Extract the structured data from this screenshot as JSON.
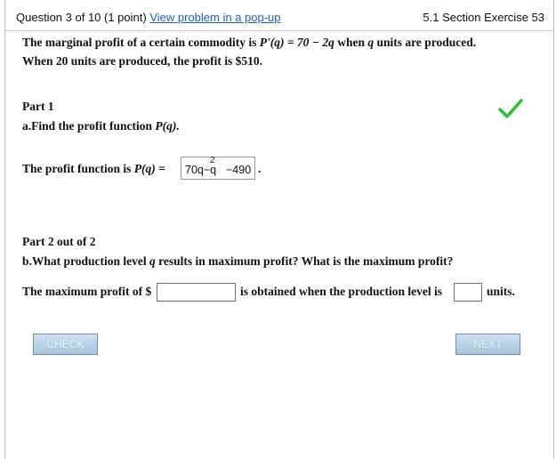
{
  "header": {
    "question_prefix": "Question 3 of 10 (1 point)",
    "popup_link": "View problem in a pop-up",
    "section": "5.1 Section Exercise 53"
  },
  "problem": {
    "line1_a": "The marginal profit of a certain commodity is ",
    "line1_expr": "P'(q) = 70 − 2q",
    "line1_b": " when ",
    "line1_q": "q",
    "line1_c": " units are produced.",
    "line2": "When 20 units are produced, the profit is $510."
  },
  "part1": {
    "title": "Part 1",
    "question_a": "a.Find the profit function ",
    "question_expr": "P(q).",
    "answer_label_a": "The profit function is ",
    "answer_label_expr": "P(q) =",
    "answer_main": "70q−q",
    "answer_exponent": "2",
    "answer_rest": "−490",
    "answer_suffix": ".",
    "status_icon": "green-checkmark-icon"
  },
  "part2": {
    "title": "Part 2 out of 2",
    "question_a": "b.What production level ",
    "question_q": "q",
    "question_b": " results in maximum profit? What is the maximum profit?",
    "label_profit": "The maximum profit of $",
    "profit_value": "",
    "label_level": "is obtained when the production level is",
    "level_value": "",
    "label_units": "units."
  },
  "buttons": {
    "check": "CHECK",
    "next": "NEXT"
  },
  "colors": {
    "link": "#1f5fb3",
    "check_green": "#2fbf2f",
    "button": "#b8cfe6"
  }
}
